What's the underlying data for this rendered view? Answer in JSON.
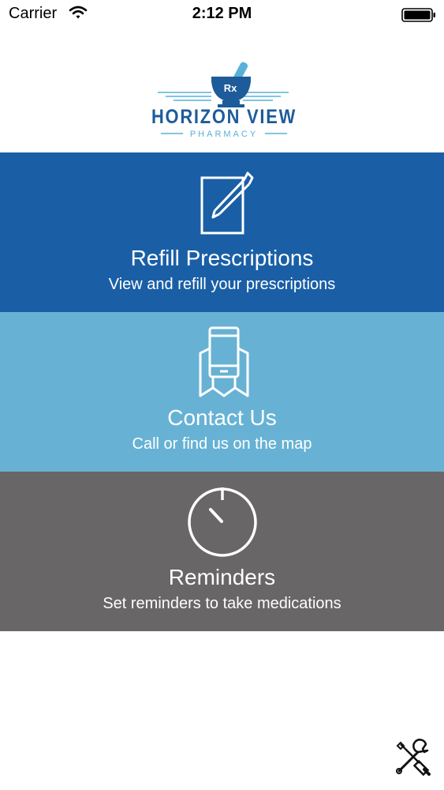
{
  "status_bar": {
    "carrier": "Carrier",
    "time": "2:12 PM"
  },
  "logo": {
    "name": "HORIZON VIEW",
    "tagline": "PHARMACY",
    "mark": "Rx"
  },
  "colors": {
    "refill": "#1a5fa6",
    "contact": "#67b2d4",
    "reminders": "#686667",
    "brand": "#1d5b9b",
    "accent": "#5ab0d8"
  },
  "menu": [
    {
      "title": "Refill Prescriptions",
      "subtitle": "View and refill your prescriptions",
      "icon": "notepad-pencil-icon"
    },
    {
      "title": "Contact Us",
      "subtitle": "Call or find us on the map",
      "icon": "phone-map-icon"
    },
    {
      "title": "Reminders",
      "subtitle": "Set reminders to take medications",
      "icon": "clock-icon"
    }
  ],
  "toolbar": {
    "settings_icon": "tools-icon"
  }
}
